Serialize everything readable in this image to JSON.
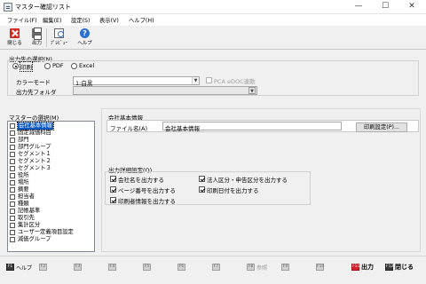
{
  "window": {
    "title": "マスター確認リスト",
    "minimize": "—",
    "maximize": "☐",
    "close": "✕"
  },
  "menu": [
    "ファイル(F)",
    "編集(E)",
    "設定(S)",
    "表示(V)",
    "ヘルプ(H)"
  ],
  "toolbar": {
    "close": "閉じる",
    "output": "出力",
    "preview": "ﾌﾟﾚﾋﾞｭｰ",
    "help": "ヘルプ"
  },
  "output_dest": {
    "title": "出力先の選択(N)",
    "options": [
      "印刷",
      "PDF",
      "Excel"
    ],
    "selected": "印刷",
    "color_mode_label": "カラーモード",
    "color_mode_value": "1:白黒",
    "pca_checkbox": "PCA eDOC連動",
    "folder_label": "出力先フォルダ",
    "folder_value": ""
  },
  "master_select": {
    "title": "マスターの選択(M)",
    "items": [
      "会社基本情報",
      "固定減価科目",
      "部門",
      "部門グループ",
      "セグメント１",
      "セグメント２",
      "セグメント３",
      "役所",
      "場所",
      "摘要",
      "担当者",
      "種類",
      "記帳基準",
      "取引先",
      "集計区分",
      "ユーザー定義項目設定",
      "減価グループ"
    ],
    "selected_index": 0
  },
  "company_info": {
    "title": "会社基本情報",
    "filename_label": "ファイル名(A)",
    "filename_value": "会社基本情報",
    "print_settings_button": "印刷設定(P)..."
  },
  "detail_settings": {
    "title": "出力詳細設定(Q)",
    "options": [
      {
        "label": "会社名を出力する",
        "checked": true
      },
      {
        "label": "法人区分・申告区分を出力する",
        "checked": true
      },
      {
        "label": "ページ番号を出力する",
        "checked": true
      },
      {
        "label": "印刷日付を出力する",
        "checked": true
      },
      {
        "label": "印刷者情報を出力する",
        "checked": true
      }
    ]
  },
  "fkeys": [
    {
      "key": "F1",
      "label": "ヘルプ",
      "state": "active"
    },
    {
      "key": "F2",
      "label": "",
      "state": "disabled"
    },
    {
      "key": "F3",
      "label": "",
      "state": "disabled"
    },
    {
      "key": "F4",
      "label": "",
      "state": "disabled"
    },
    {
      "key": "F5",
      "label": "",
      "state": "disabled"
    },
    {
      "key": "F6",
      "label": "",
      "state": "disabled"
    },
    {
      "key": "F7",
      "label": "",
      "state": "disabled"
    },
    {
      "key": "F8",
      "label": "参照",
      "state": "disabled"
    },
    {
      "key": "F9",
      "label": "",
      "state": "disabled"
    },
    {
      "key": "F10",
      "label": "",
      "state": "disabled"
    },
    {
      "key": "F11",
      "label": "出力",
      "state": "red"
    },
    {
      "key": "F12",
      "label": "閉じる",
      "state": "active"
    }
  ],
  "colors": {
    "selection": "#0a59c4",
    "accent_red": "#d4202a"
  }
}
